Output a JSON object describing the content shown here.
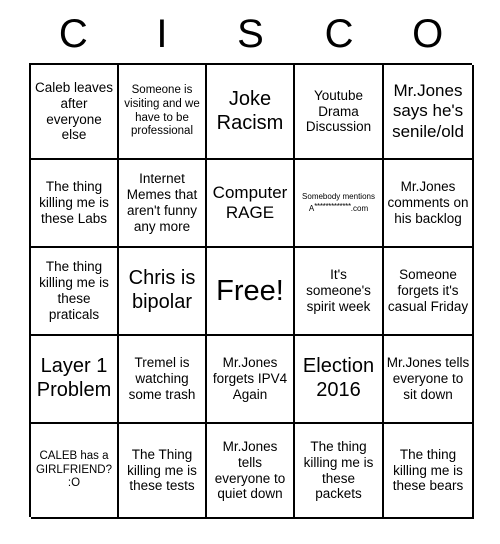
{
  "header": {
    "letters": [
      "C",
      "I",
      "S",
      "C",
      "O"
    ]
  },
  "grid": {
    "rows": 5,
    "columns": 5,
    "cells": [
      {
        "text": "Caleb leaves after everyone else",
        "size": "fs-med",
        "free": false
      },
      {
        "text": "Someone is visiting and we have to be professional",
        "size": "fs-small",
        "free": false
      },
      {
        "text": "Joke Racism",
        "size": "fs-xl",
        "free": false
      },
      {
        "text": "Youtube Drama Discussion",
        "size": "fs-med",
        "free": false
      },
      {
        "text": "Mr.Jones says he's senile/old",
        "size": "fs-large",
        "free": false
      },
      {
        "text": "The thing killing me is these Labs",
        "size": "fs-med",
        "free": false
      },
      {
        "text": "Internet Memes that aren't funny any more",
        "size": "fs-med",
        "free": false
      },
      {
        "text": "Computer RAGE",
        "size": "fs-large",
        "free": false
      },
      {
        "text": "Somebody mentions A*************.com",
        "size": "fs-tiny",
        "free": false,
        "censored": true,
        "censor_prefix": "Somebody mentions",
        "censor_head": "A",
        "censor_stars": "*************",
        "censor_tail": ".com"
      },
      {
        "text": "Mr.Jones comments on his backlog",
        "size": "fs-med",
        "free": false
      },
      {
        "text": "The thing killing me is these praticals",
        "size": "fs-med",
        "free": false
      },
      {
        "text": "Chris is bipolar",
        "size": "fs-xl",
        "free": false
      },
      {
        "text": "Free!",
        "size": "fs-free",
        "free": true
      },
      {
        "text": "It's someone's spirit week",
        "size": "fs-med",
        "free": false
      },
      {
        "text": "Someone forgets it's casual Friday",
        "size": "fs-med",
        "free": false
      },
      {
        "text": "Layer 1 Problem",
        "size": "fs-xl",
        "free": false
      },
      {
        "text": "Tremel is watching some trash",
        "size": "fs-med",
        "free": false
      },
      {
        "text": "Mr.Jones forgets IPV4 Again",
        "size": "fs-med",
        "free": false
      },
      {
        "text": "Election 2016",
        "size": "fs-xl",
        "free": false
      },
      {
        "text": "Mr.Jones tells everyone to sit down",
        "size": "fs-med",
        "free": false
      },
      {
        "text": "CALEB has a GIRLFRIEND? :O",
        "size": "fs-small",
        "free": false
      },
      {
        "text": "The Thing killing me is these tests",
        "size": "fs-med",
        "free": false
      },
      {
        "text": "Mr.Jones tells everyone to quiet down",
        "size": "fs-med",
        "free": false
      },
      {
        "text": "The thing killing me is these packets",
        "size": "fs-med",
        "free": false
      },
      {
        "text": "The thing killing me is these bears",
        "size": "fs-med",
        "free": false
      }
    ]
  },
  "colors": {
    "background": "#ffffff",
    "text": "#000000",
    "border": "#000000"
  }
}
